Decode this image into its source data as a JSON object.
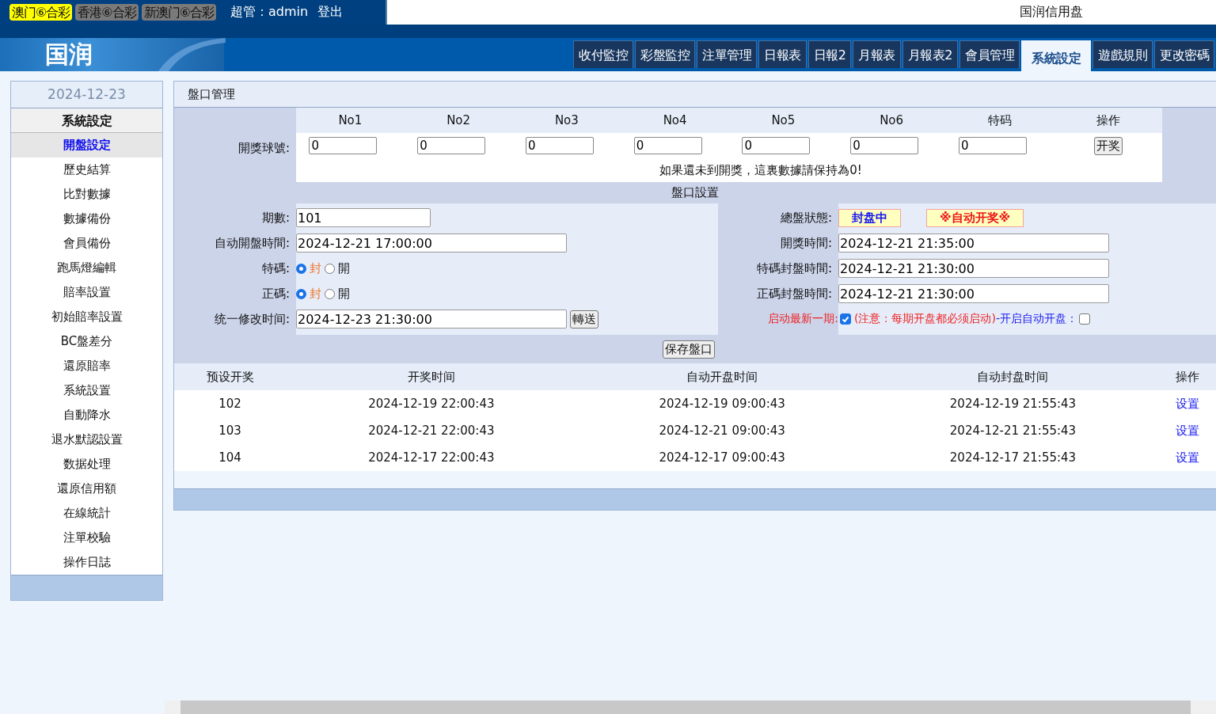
{
  "lottery_tabs": [
    {
      "label": "澳门⑥合彩",
      "selected": true
    },
    {
      "label": "香港⑥合彩",
      "selected": false
    },
    {
      "label": "新澳门⑥合彩",
      "selected": false
    }
  ],
  "user": "超管：admin",
  "logout": "登出",
  "site_name": "国润信用盘",
  "logo": "国润",
  "nav_tabs": [
    {
      "label": "收付監控",
      "selected": false
    },
    {
      "label": "彩盤監控",
      "selected": false
    },
    {
      "label": "注單管理",
      "selected": false
    },
    {
      "label": "日報表",
      "selected": false
    },
    {
      "label": "日報2",
      "selected": false
    },
    {
      "label": "月報表",
      "selected": false
    },
    {
      "label": "月報表2",
      "selected": false
    },
    {
      "label": "會員管理",
      "selected": false
    },
    {
      "label": "系統設定",
      "selected": true
    },
    {
      "label": "遊戲規則",
      "selected": false
    },
    {
      "label": "更改密碼",
      "selected": false
    }
  ],
  "sidebar": {
    "date": "2024-12-23",
    "heading": "系統設定",
    "items": [
      {
        "label": "開盤設定",
        "selected": true
      },
      {
        "label": "歷史結算",
        "selected": false
      },
      {
        "label": "比對數據",
        "selected": false
      },
      {
        "label": "數據備份",
        "selected": false
      },
      {
        "label": "會員備份",
        "selected": false
      },
      {
        "label": "跑馬燈編輯",
        "selected": false
      },
      {
        "label": "賠率設置",
        "selected": false
      },
      {
        "label": "初始賠率設置",
        "selected": false
      },
      {
        "label": "BC盤差分",
        "selected": false
      },
      {
        "label": "還原賠率",
        "selected": false
      },
      {
        "label": "系統設置",
        "selected": false
      },
      {
        "label": "自動降水",
        "selected": false
      },
      {
        "label": "退水默認設置",
        "selected": false
      },
      {
        "label": "数据处理",
        "selected": false
      },
      {
        "label": "還原信用額",
        "selected": false
      },
      {
        "label": "在線統計",
        "selected": false
      },
      {
        "label": "注單校驗",
        "selected": false
      },
      {
        "label": "操作日誌",
        "selected": false
      }
    ]
  },
  "panel_title": "盤口管理",
  "draw": {
    "label": "開獎球號:",
    "columns": [
      "No1",
      "No2",
      "No3",
      "No4",
      "No5",
      "No6",
      "特码"
    ],
    "action_header": "操作",
    "values": [
      "0",
      "0",
      "0",
      "0",
      "0",
      "0",
      "0"
    ],
    "button": "开奖",
    "note": "如果還未到開獎，這裏數據請保持為0!"
  },
  "settings_title": "盤口設置",
  "left_fields": [
    {
      "kind": "short_input",
      "label": "期數:",
      "value": "101"
    },
    {
      "kind": "input",
      "label": "自动開盤時間:",
      "value": "2024-12-21 17:00:00"
    },
    {
      "kind": "radio",
      "label": "特碼:",
      "options": [
        {
          "label": "封",
          "selected": true
        },
        {
          "label": "開",
          "selected": false
        }
      ]
    },
    {
      "kind": "radio",
      "label": "正碼:",
      "options": [
        {
          "label": "封",
          "selected": true
        },
        {
          "label": "開",
          "selected": false
        }
      ]
    },
    {
      "kind": "input_button",
      "label": "统一修改时间:",
      "value": "2024-12-23 21:30:00",
      "button": "轉送"
    }
  ],
  "status": {
    "label": "總盤狀態:",
    "badges": [
      "封盘中",
      "※自动开奖※"
    ]
  },
  "right_fields": [
    {
      "label": "開獎時間:",
      "value": "2024-12-21 21:35:00"
    },
    {
      "label": "特碼封盤時間:",
      "value": "2024-12-21 21:30:00"
    },
    {
      "label": "正碼封盤時間:",
      "value": "2024-12-21 21:30:00"
    }
  ],
  "start_latest": {
    "label": "启动最新一期:",
    "checked": true,
    "note": "(注意：每期开盘都必须启动)",
    "auto_open_label": "-开启自动开盘：",
    "auto_open_checked": false
  },
  "save_button": "保存盤口",
  "table": {
    "columns": [
      "预设开奖",
      "开奖时间",
      "自动开盘时间",
      "自动封盘时间",
      "操作"
    ],
    "rows": [
      {
        "cells": [
          "102",
          "2024-12-19 22:00:43",
          "2024-12-19 09:00:43",
          "2024-12-19 21:55:43"
        ],
        "action": "设置"
      },
      {
        "cells": [
          "103",
          "2024-12-21 22:00:43",
          "2024-12-21 09:00:43",
          "2024-12-21 21:55:43"
        ],
        "action": "设置"
      },
      {
        "cells": [
          "104",
          "2024-12-17 22:00:43",
          "2024-12-17 09:00:43",
          "2024-12-17 21:55:43"
        ],
        "action": "设置"
      }
    ]
  }
}
